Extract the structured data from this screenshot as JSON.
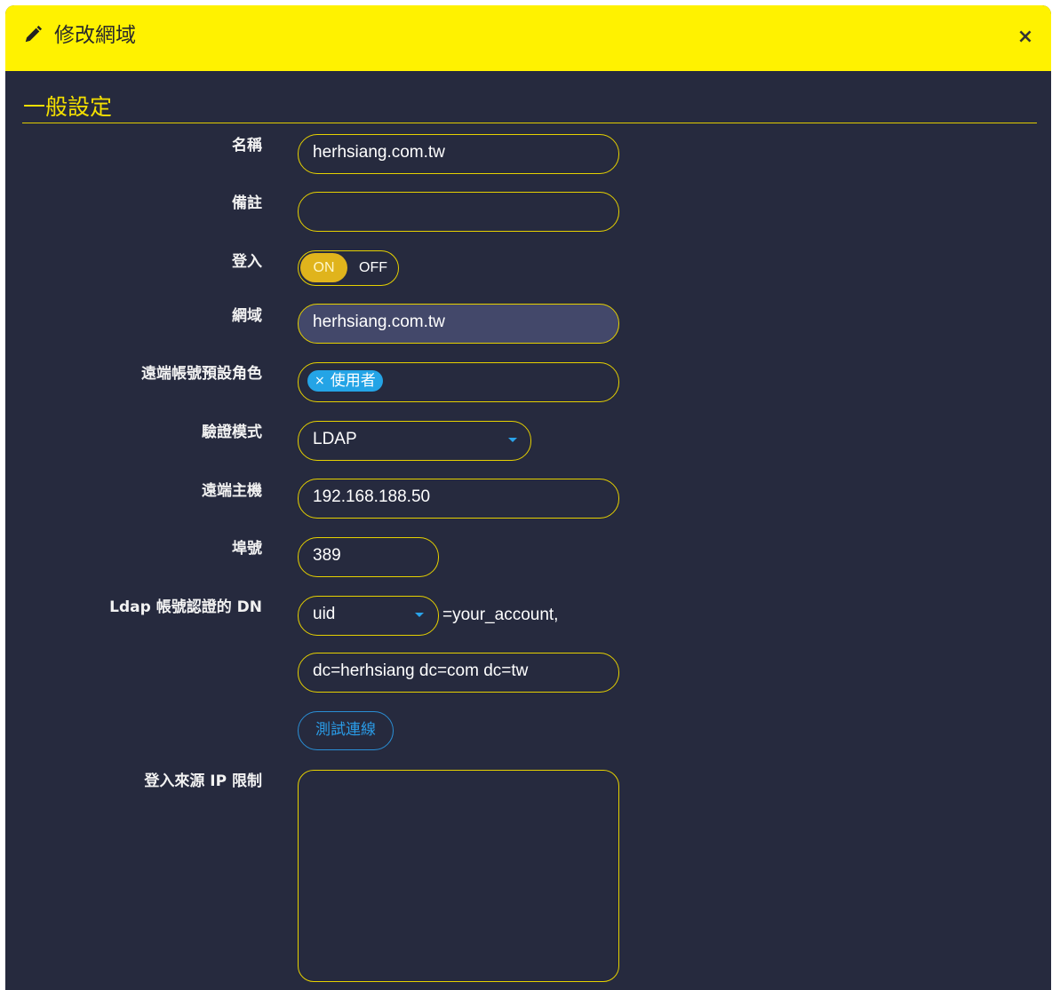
{
  "dialog": {
    "title": "修改網域",
    "close_symbol": "×",
    "icons": {
      "title_icon": "pencil-icon",
      "close_icon": "close-icon"
    }
  },
  "section": {
    "title": "一般設定"
  },
  "colors": {
    "header_bg": "#fff200",
    "body_bg": "#262a3e",
    "accent_yellow": "#e6d100",
    "tag_blue": "#24a4e6",
    "button_blue": "#2a9be6"
  },
  "form": {
    "name": {
      "label": "名稱",
      "value": "herhsiang.com.tw"
    },
    "remark": {
      "label": "備註",
      "value": ""
    },
    "login": {
      "label": "登入",
      "on_label": "ON",
      "off_label": "OFF",
      "state": "ON"
    },
    "domain": {
      "label": "網域",
      "value": "herhsiang.com.tw"
    },
    "default_role": {
      "label": "遠端帳號預設角色",
      "tag_remove": "×",
      "tag": "使用者"
    },
    "auth_mode": {
      "label": "驗證模式",
      "value": "LDAP"
    },
    "remote_host": {
      "label": "遠端主機",
      "value": "192.168.188.50"
    },
    "port": {
      "label": "埠號",
      "value": "389"
    },
    "ldap_dn": {
      "label": "Ldap 帳號認證的 DN",
      "attribute": "uid",
      "suffix": "=your_account,",
      "base_dn": "dc=herhsiang dc=com dc=tw"
    },
    "test_button": "測試連線",
    "ip_restriction": {
      "label": "登入來源 IP 限制",
      "value": ""
    }
  }
}
